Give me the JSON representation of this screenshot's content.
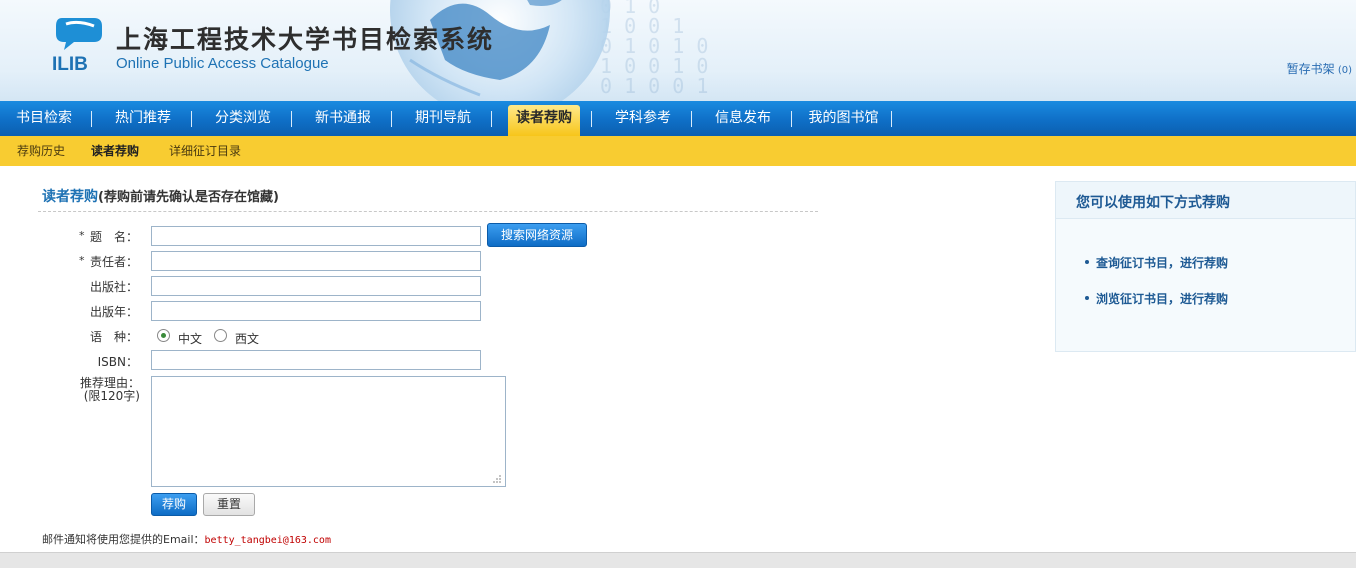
{
  "header": {
    "logo_text": "ILIB",
    "title": "上海工程技术大学书目检索系统",
    "subtitle": "Online Public Access Catalogue",
    "shelf_link": "暂存书架",
    "shelf_count": "(0)"
  },
  "nav": {
    "items": [
      {
        "label": "书目检索"
      },
      {
        "label": "热门推荐"
      },
      {
        "label": "分类浏览"
      },
      {
        "label": "新书通报"
      },
      {
        "label": "期刊导航"
      },
      {
        "label": "读者荐购"
      },
      {
        "label": "学科参考"
      },
      {
        "label": "信息发布"
      },
      {
        "label": "我的图书馆"
      }
    ],
    "active_index": 5
  },
  "subnav": {
    "items": [
      {
        "label": "荐购历史"
      },
      {
        "label": "读者荐购"
      },
      {
        "label": "详细征订目录"
      }
    ]
  },
  "form": {
    "title": "读者荐购",
    "note": "(荐购前请先确认是否存在馆藏)",
    "required_mark": "*",
    "fields": {
      "title_label": "题　名：",
      "author_label": "责任者：",
      "publisher_label": "出版社：",
      "year_label": "出版年：",
      "language_label": "语　种：",
      "isbn_label": "ISBN：",
      "reason_label": "推荐理由：",
      "reason_limit": "(限120字)"
    },
    "values": {
      "title": "",
      "author": "",
      "publisher": "",
      "year": "",
      "isbn": "",
      "reason": ""
    },
    "language_options": [
      {
        "label": "中文",
        "checked": true
      },
      {
        "label": "西文",
        "checked": false
      }
    ],
    "search_button": "搜索网络资源",
    "submit_button": "荐购",
    "reset_button": "重置",
    "email_note": "邮件通知将使用您提供的Email：",
    "email": "betty_tangbei@163.com"
  },
  "side": {
    "title": "您可以使用如下方式荐购",
    "links": [
      {
        "label": "查询征订书目，进行荐购"
      },
      {
        "label": "浏览征订书目，进行荐购"
      }
    ]
  },
  "colors": {
    "nav_blue": "#0f6fc7",
    "subnav_yellow": "#f8cc31",
    "link_blue": "#1e72b4",
    "email_red": "#c00000"
  }
}
